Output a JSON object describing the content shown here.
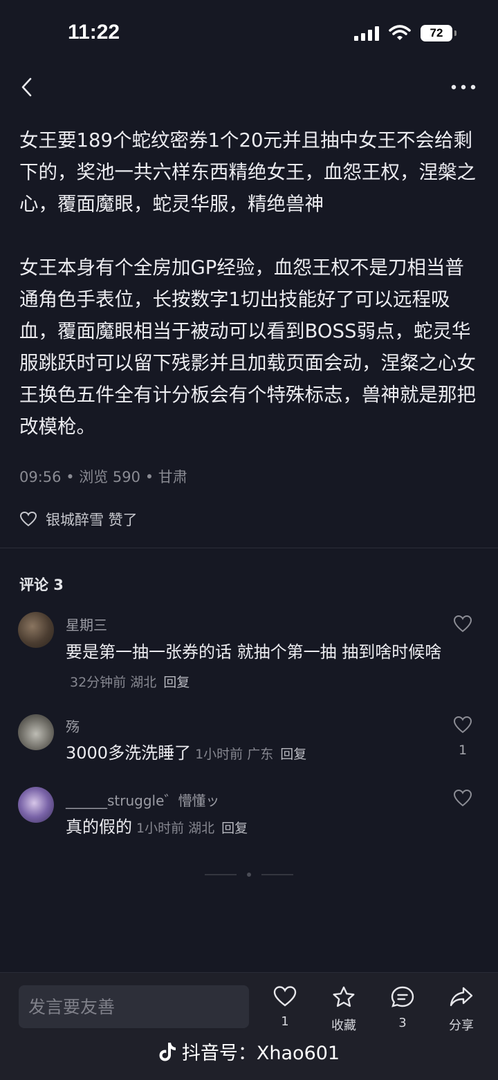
{
  "status_bar": {
    "time": "11:22",
    "battery": "72"
  },
  "post": {
    "paragraphs": [
      "女王要189个蛇纹密券1个20元并且抽中女王不会给剩下的，奖池一共六样东西精绝女王，血怨王权，涅槃之心，覆面魔眼，蛇灵华服，精绝兽神",
      "女王本身有个全房加GP经验，血怨王权不是刀相当普通角色手表位，长按数字1切出技能好了可以远程吸血，覆面魔眼相当于被动可以看到BOSS弱点，蛇灵华服跳跃时可以留下残影并且加载页面会动，涅粲之心女王换色五件全有计分板会有个特殊标志，兽神就是那把改模枪。"
    ],
    "meta": "09:56 • 浏览 590 • 甘肃",
    "liked_by": "银城醉雪 赞了"
  },
  "comments_title": "评论 3",
  "comments": [
    {
      "name": "星期三",
      "text": "要是第一抽一张券的话 就抽个第一抽 抽到啥时候啥",
      "time": "32分钟前 湖北",
      "reply": "回复",
      "likes": ""
    },
    {
      "name": "殇",
      "text": "3000多洗洗睡了",
      "time": "1小时前 广东",
      "reply": "回复",
      "likes": "1"
    },
    {
      "name": "______struggle゛懵懂ッ",
      "text": "真的假的",
      "time": "1小时前 湖北",
      "reply": "回复",
      "likes": ""
    }
  ],
  "bottom_bar": {
    "input_placeholder": "发言要友善",
    "like_count": "1",
    "favorite_label": "收藏",
    "comment_count": "3",
    "share_label": "分享",
    "watermark": "抖音号：Xhao601"
  }
}
